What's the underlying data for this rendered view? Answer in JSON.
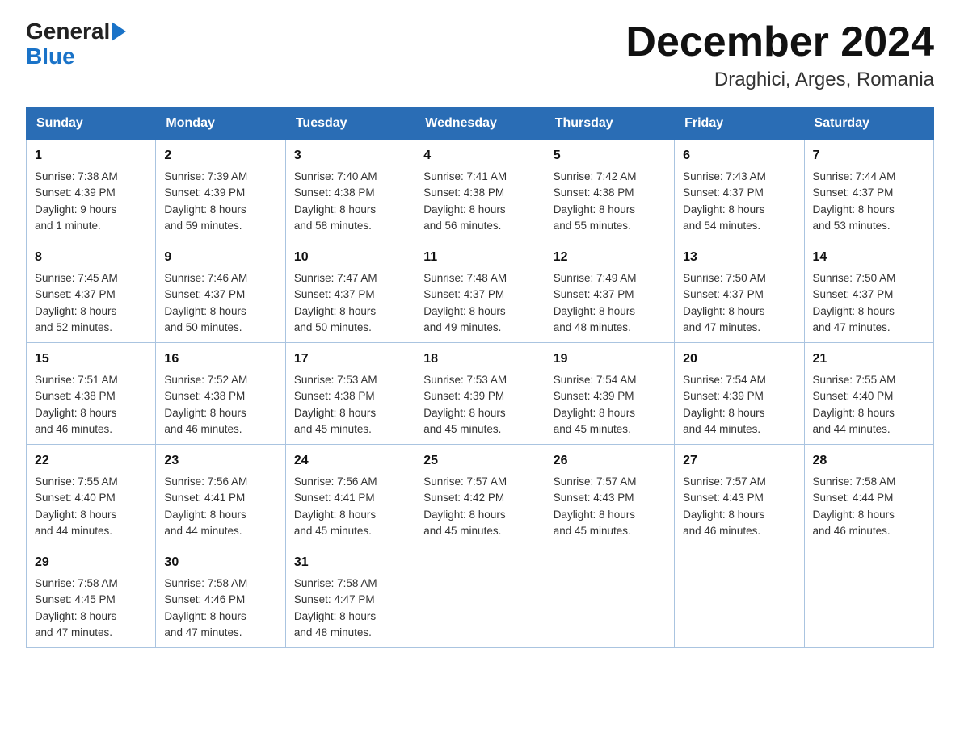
{
  "header": {
    "logo_general": "General",
    "logo_blue": "Blue",
    "title": "December 2024",
    "subtitle": "Draghici, Arges, Romania"
  },
  "days_of_week": [
    "Sunday",
    "Monday",
    "Tuesday",
    "Wednesday",
    "Thursday",
    "Friday",
    "Saturday"
  ],
  "weeks": [
    [
      {
        "day": "1",
        "sunrise": "7:38 AM",
        "sunset": "4:39 PM",
        "daylight": "9 hours and 1 minute."
      },
      {
        "day": "2",
        "sunrise": "7:39 AM",
        "sunset": "4:39 PM",
        "daylight": "8 hours and 59 minutes."
      },
      {
        "day": "3",
        "sunrise": "7:40 AM",
        "sunset": "4:38 PM",
        "daylight": "8 hours and 58 minutes."
      },
      {
        "day": "4",
        "sunrise": "7:41 AM",
        "sunset": "4:38 PM",
        "daylight": "8 hours and 56 minutes."
      },
      {
        "day": "5",
        "sunrise": "7:42 AM",
        "sunset": "4:38 PM",
        "daylight": "8 hours and 55 minutes."
      },
      {
        "day": "6",
        "sunrise": "7:43 AM",
        "sunset": "4:37 PM",
        "daylight": "8 hours and 54 minutes."
      },
      {
        "day": "7",
        "sunrise": "7:44 AM",
        "sunset": "4:37 PM",
        "daylight": "8 hours and 53 minutes."
      }
    ],
    [
      {
        "day": "8",
        "sunrise": "7:45 AM",
        "sunset": "4:37 PM",
        "daylight": "8 hours and 52 minutes."
      },
      {
        "day": "9",
        "sunrise": "7:46 AM",
        "sunset": "4:37 PM",
        "daylight": "8 hours and 50 minutes."
      },
      {
        "day": "10",
        "sunrise": "7:47 AM",
        "sunset": "4:37 PM",
        "daylight": "8 hours and 50 minutes."
      },
      {
        "day": "11",
        "sunrise": "7:48 AM",
        "sunset": "4:37 PM",
        "daylight": "8 hours and 49 minutes."
      },
      {
        "day": "12",
        "sunrise": "7:49 AM",
        "sunset": "4:37 PM",
        "daylight": "8 hours and 48 minutes."
      },
      {
        "day": "13",
        "sunrise": "7:50 AM",
        "sunset": "4:37 PM",
        "daylight": "8 hours and 47 minutes."
      },
      {
        "day": "14",
        "sunrise": "7:50 AM",
        "sunset": "4:37 PM",
        "daylight": "8 hours and 47 minutes."
      }
    ],
    [
      {
        "day": "15",
        "sunrise": "7:51 AM",
        "sunset": "4:38 PM",
        "daylight": "8 hours and 46 minutes."
      },
      {
        "day": "16",
        "sunrise": "7:52 AM",
        "sunset": "4:38 PM",
        "daylight": "8 hours and 46 minutes."
      },
      {
        "day": "17",
        "sunrise": "7:53 AM",
        "sunset": "4:38 PM",
        "daylight": "8 hours and 45 minutes."
      },
      {
        "day": "18",
        "sunrise": "7:53 AM",
        "sunset": "4:39 PM",
        "daylight": "8 hours and 45 minutes."
      },
      {
        "day": "19",
        "sunrise": "7:54 AM",
        "sunset": "4:39 PM",
        "daylight": "8 hours and 45 minutes."
      },
      {
        "day": "20",
        "sunrise": "7:54 AM",
        "sunset": "4:39 PM",
        "daylight": "8 hours and 44 minutes."
      },
      {
        "day": "21",
        "sunrise": "7:55 AM",
        "sunset": "4:40 PM",
        "daylight": "8 hours and 44 minutes."
      }
    ],
    [
      {
        "day": "22",
        "sunrise": "7:55 AM",
        "sunset": "4:40 PM",
        "daylight": "8 hours and 44 minutes."
      },
      {
        "day": "23",
        "sunrise": "7:56 AM",
        "sunset": "4:41 PM",
        "daylight": "8 hours and 44 minutes."
      },
      {
        "day": "24",
        "sunrise": "7:56 AM",
        "sunset": "4:41 PM",
        "daylight": "8 hours and 45 minutes."
      },
      {
        "day": "25",
        "sunrise": "7:57 AM",
        "sunset": "4:42 PM",
        "daylight": "8 hours and 45 minutes."
      },
      {
        "day": "26",
        "sunrise": "7:57 AM",
        "sunset": "4:43 PM",
        "daylight": "8 hours and 45 minutes."
      },
      {
        "day": "27",
        "sunrise": "7:57 AM",
        "sunset": "4:43 PM",
        "daylight": "8 hours and 46 minutes."
      },
      {
        "day": "28",
        "sunrise": "7:58 AM",
        "sunset": "4:44 PM",
        "daylight": "8 hours and 46 minutes."
      }
    ],
    [
      {
        "day": "29",
        "sunrise": "7:58 AM",
        "sunset": "4:45 PM",
        "daylight": "8 hours and 47 minutes."
      },
      {
        "day": "30",
        "sunrise": "7:58 AM",
        "sunset": "4:46 PM",
        "daylight": "8 hours and 47 minutes."
      },
      {
        "day": "31",
        "sunrise": "7:58 AM",
        "sunset": "4:47 PM",
        "daylight": "8 hours and 48 minutes."
      },
      null,
      null,
      null,
      null
    ]
  ],
  "labels": {
    "sunrise": "Sunrise:",
    "sunset": "Sunset:",
    "daylight": "Daylight:"
  }
}
